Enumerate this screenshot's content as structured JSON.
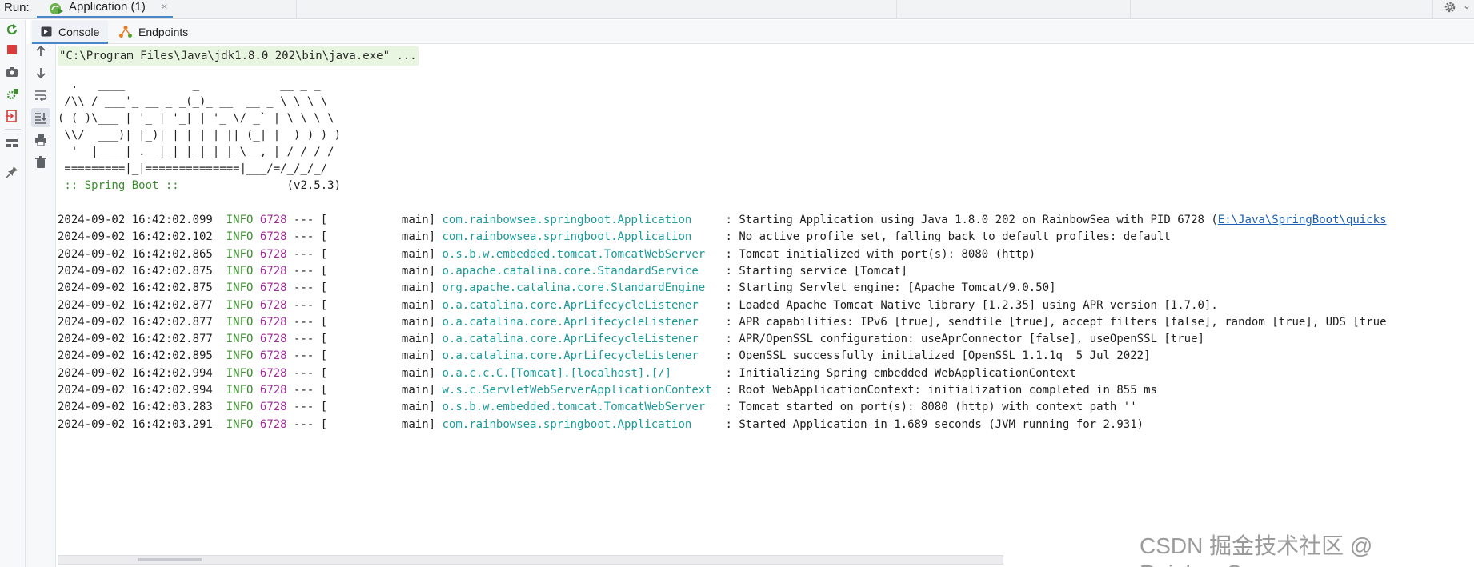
{
  "run_bar": {
    "label": "Run:",
    "tab_label": "Application (1)",
    "close_glyph": "×",
    "app_icon": "spring-run-icon",
    "settings_icon": "gear-icon",
    "menu_chevron": "⌄"
  },
  "sub_tabs": [
    {
      "label": "Console",
      "icon": "console-icon",
      "selected": true
    },
    {
      "label": "Endpoints",
      "icon": "endpoints-icon",
      "selected": false
    }
  ],
  "left_toolbar": [
    "rerun-icon",
    "stop-icon",
    "camera-icon",
    "debug-gear-icon",
    "exit-icon",
    "layout-icon",
    "pin-icon"
  ],
  "mid_toolbar": [
    "arrow-up-icon",
    "arrow-down-icon",
    "soft-wrap-icon",
    "scroll-to-end-icon",
    "print-icon",
    "trash-icon"
  ],
  "console": {
    "command": "\"C:\\Program Files\\Java\\jdk1.8.0_202\\bin\\java.exe\" ...",
    "banner": [
      "  .   ____          _            __ _ _",
      " /\\\\ / ___'_ __ _ _(_)_ __  __ _ \\ \\ \\ \\",
      "( ( )\\___ | '_ | '_| | '_ \\/ _` | \\ \\ \\ \\",
      " \\\\/  ___)| |_)| | | | | || (_| |  ) ) ) )",
      "  '  |____| .__|_| |_|_| |_\\__, | / / / /",
      " =========|_|==============|___/=/_/_/_/"
    ],
    "spring_boot_tag": " :: Spring Boot :: ",
    "spring_boot_version": "               (v2.5.3)",
    "logs": [
      {
        "ts": "2024-09-02 16:42:02.099",
        "level": "INFO",
        "pid": "6728",
        "thread": "main",
        "logger": "com.rainbowsea.springboot.Application    ",
        "message": " : Starting Application using Java 1.8.0_202 on RainbowSea with PID 6728 (",
        "link": "E:\\Java\\SpringBoot\\quicks"
      },
      {
        "ts": "2024-09-02 16:42:02.102",
        "level": "INFO",
        "pid": "6728",
        "thread": "main",
        "logger": "com.rainbowsea.springboot.Application    ",
        "message": " : No active profile set, falling back to default profiles: default"
      },
      {
        "ts": "2024-09-02 16:42:02.865",
        "level": "INFO",
        "pid": "6728",
        "thread": "main",
        "logger": "o.s.b.w.embedded.tomcat.TomcatWebServer  ",
        "message": " : Tomcat initialized with port(s): 8080 (http)"
      },
      {
        "ts": "2024-09-02 16:42:02.875",
        "level": "INFO",
        "pid": "6728",
        "thread": "main",
        "logger": "o.apache.catalina.core.StandardService   ",
        "message": " : Starting service [Tomcat]"
      },
      {
        "ts": "2024-09-02 16:42:02.875",
        "level": "INFO",
        "pid": "6728",
        "thread": "main",
        "logger": "org.apache.catalina.core.StandardEngine  ",
        "message": " : Starting Servlet engine: [Apache Tomcat/9.0.50]"
      },
      {
        "ts": "2024-09-02 16:42:02.877",
        "level": "INFO",
        "pid": "6728",
        "thread": "main",
        "logger": "o.a.catalina.core.AprLifecycleListener   ",
        "message": " : Loaded Apache Tomcat Native library [1.2.35] using APR version [1.7.0]."
      },
      {
        "ts": "2024-09-02 16:42:02.877",
        "level": "INFO",
        "pid": "6728",
        "thread": "main",
        "logger": "o.a.catalina.core.AprLifecycleListener   ",
        "message": " : APR capabilities: IPv6 [true], sendfile [true], accept filters [false], random [true], UDS [true"
      },
      {
        "ts": "2024-09-02 16:42:02.877",
        "level": "INFO",
        "pid": "6728",
        "thread": "main",
        "logger": "o.a.catalina.core.AprLifecycleListener   ",
        "message": " : APR/OpenSSL configuration: useAprConnector [false], useOpenSSL [true]"
      },
      {
        "ts": "2024-09-02 16:42:02.895",
        "level": "INFO",
        "pid": "6728",
        "thread": "main",
        "logger": "o.a.catalina.core.AprLifecycleListener   ",
        "message": " : OpenSSL successfully initialized [OpenSSL 1.1.1q  5 Jul 2022]"
      },
      {
        "ts": "2024-09-02 16:42:02.994",
        "level": "INFO",
        "pid": "6728",
        "thread": "main",
        "logger": "o.a.c.c.C.[Tomcat].[localhost].[/]       ",
        "message": " : Initializing Spring embedded WebApplicationContext"
      },
      {
        "ts": "2024-09-02 16:42:02.994",
        "level": "INFO",
        "pid": "6728",
        "thread": "main",
        "logger": "w.s.c.ServletWebServerApplicationContext ",
        "message": " : Root WebApplicationContext: initialization completed in 855 ms"
      },
      {
        "ts": "2024-09-02 16:42:03.283",
        "level": "INFO",
        "pid": "6728",
        "thread": "main",
        "logger": "o.s.b.w.embedded.tomcat.TomcatWebServer  ",
        "message": " : Tomcat started on port(s): 8080 (http) with context path ''"
      },
      {
        "ts": "2024-09-02 16:42:03.291",
        "level": "INFO",
        "pid": "6728",
        "thread": "main",
        "logger": "com.rainbowsea.springboot.Application    ",
        "message": " : Started Application in 1.689 seconds (JVM running for 2.931)"
      }
    ]
  },
  "watermark": "CSDN 掘金技术社区 @ RainbowSea",
  "colors": {
    "level": "#3c8e2f",
    "pid": "#a32c9c",
    "logger": "#1d9a9a",
    "link": "#1a5fb4",
    "command_bg": "#e8f5e0",
    "tab_accent": "#4a87c8"
  }
}
